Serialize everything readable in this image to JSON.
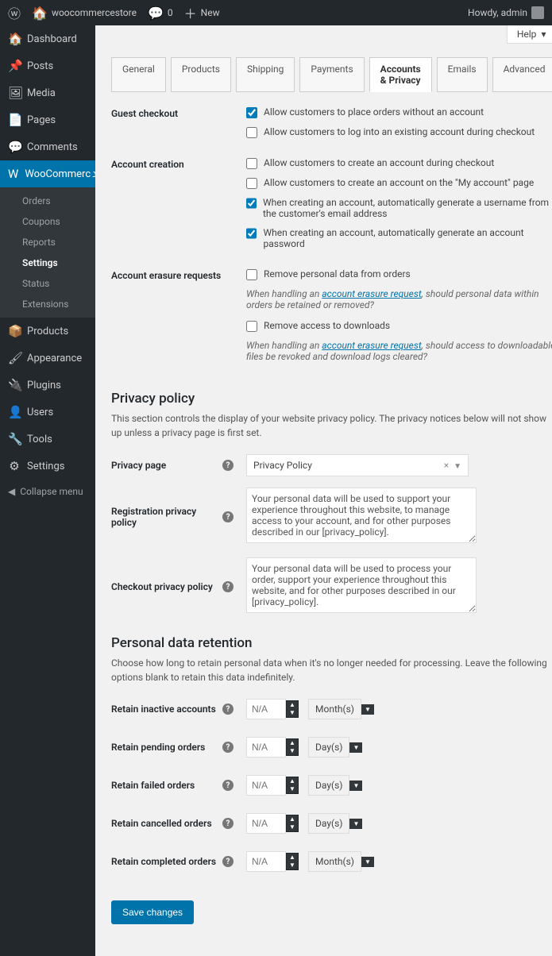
{
  "adminbar": {
    "site_name": "woocommercestore",
    "comments_count": "0",
    "new_label": "New",
    "howdy": "Howdy, admin"
  },
  "sidebar": {
    "items": [
      {
        "icon": "🏠",
        "label": "Dashboard"
      },
      {
        "icon": "📌",
        "label": "Posts"
      },
      {
        "icon": "🖼",
        "label": "Media"
      },
      {
        "icon": "📄",
        "label": "Pages"
      },
      {
        "icon": "💬",
        "label": "Comments"
      }
    ],
    "woo": {
      "label": "WooCommerce"
    },
    "woo_sub": [
      "Orders",
      "Coupons",
      "Reports",
      "Settings",
      "Status",
      "Extensions"
    ],
    "items2": [
      {
        "icon": "📦",
        "label": "Products"
      },
      {
        "icon": "🖌",
        "label": "Appearance"
      },
      {
        "icon": "🔌",
        "label": "Plugins"
      },
      {
        "icon": "👤",
        "label": "Users"
      },
      {
        "icon": "🔧",
        "label": "Tools"
      },
      {
        "icon": "⚙",
        "label": "Settings"
      }
    ],
    "collapse": "Collapse menu"
  },
  "help_tab": "Help",
  "tabs": [
    "General",
    "Products",
    "Shipping",
    "Payments",
    "Accounts & Privacy",
    "Emails",
    "Advanced"
  ],
  "active_tab": 4,
  "guest": {
    "title": "Guest checkout",
    "c1": {
      "label": "Allow customers to place orders without an account",
      "checked": true
    },
    "c2": {
      "label": "Allow customers to log into an existing account during checkout",
      "checked": false
    }
  },
  "creation": {
    "title": "Account creation",
    "c1": {
      "label": "Allow customers to create an account during checkout",
      "checked": false
    },
    "c2": {
      "label": "Allow customers to create an account on the \"My account\" page",
      "checked": false
    },
    "c3": {
      "label": "When creating an account, automatically generate a username from the customer's email address",
      "checked": true
    },
    "c4": {
      "label": "When creating an account, automatically generate an account password",
      "checked": true
    }
  },
  "erasure": {
    "title": "Account erasure requests",
    "c1": {
      "label": "Remove personal data from orders",
      "checked": false
    },
    "h1_pre": "When handling an ",
    "h1_link": "account erasure request",
    "h1_post": ", should personal data within orders be retained or removed?",
    "c2": {
      "label": "Remove access to downloads",
      "checked": false
    },
    "h2_pre": "When handling an ",
    "h2_link": "account erasure request",
    "h2_post": ", should access to downloadable files be revoked and download logs cleared?"
  },
  "privacy": {
    "title": "Privacy policy",
    "desc": "This section controls the display of your website privacy policy. The privacy notices below will not show up unless a privacy page is first set.",
    "page_label": "Privacy page",
    "page_value": "Privacy Policy",
    "reg_label": "Registration privacy policy",
    "reg_text": "Your personal data will be used to support your experience throughout this website, to manage access to your account, and for other purposes described in our [privacy_policy].",
    "checkout_label": "Checkout privacy policy",
    "checkout_text": "Your personal data will be used to process your order, support your experience throughout this website, and for other purposes described in our [privacy_policy]."
  },
  "retention": {
    "title": "Personal data retention",
    "desc": "Choose how long to retain personal data when it's no longer needed for processing. Leave the following options blank to retain this data indefinitely.",
    "rows": [
      {
        "label": "Retain inactive accounts",
        "value": "N/A",
        "unit": "Month(s)"
      },
      {
        "label": "Retain pending orders",
        "value": "N/A",
        "unit": "Day(s)"
      },
      {
        "label": "Retain failed orders",
        "value": "N/A",
        "unit": "Day(s)"
      },
      {
        "label": "Retain cancelled orders",
        "value": "N/A",
        "unit": "Day(s)"
      },
      {
        "label": "Retain completed orders",
        "value": "N/A",
        "unit": "Month(s)"
      }
    ]
  },
  "save_btn": "Save changes"
}
